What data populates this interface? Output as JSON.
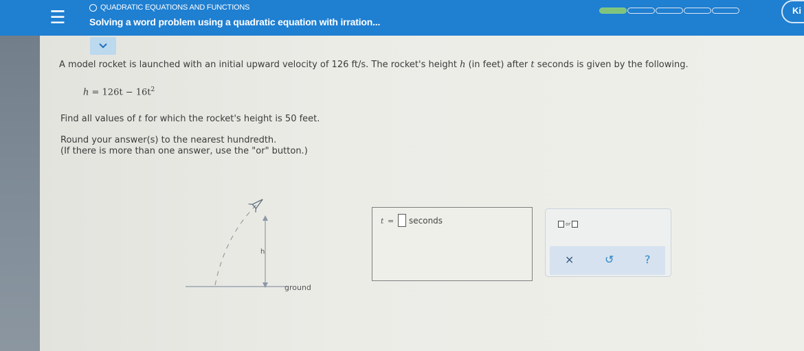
{
  "header": {
    "menu_icon": "hamburger-menu-icon",
    "topic": "QUADRATIC EQUATIONS AND FUNCTIONS",
    "lesson_title": "Solving a word problem using a quadratic equation with irration...",
    "progress": {
      "filled": 1,
      "total": 5
    },
    "profile_label": "Ki",
    "colors": {
      "bar": "#1f7fd1",
      "progress_fill": "#7fc47a"
    }
  },
  "expand_icon": "chevron-down-icon",
  "problem": {
    "intro_a": "A model rocket is launched with an initial upward velocity of 126",
    "intro_unit": "ft/s",
    "intro_b": ". The rocket's height",
    "var_h": "h",
    "intro_c": "(in feet) after",
    "var_t": "t",
    "intro_d": "seconds is given by the following.",
    "formula": {
      "lhs": "h",
      "rhs": " = 126t − 16t",
      "exponent": "2"
    },
    "find_a": "Find all values of",
    "find_var": "t",
    "find_b": "for which the rocket's height is 50 feet.",
    "round_line1": "Round your answer(s) to the nearest hundredth.",
    "round_line2": "(If there is more than one answer, use the \"or\" button.)"
  },
  "diagram": {
    "height_label": "h",
    "ground_label": "ground",
    "rocket_icon": "rocket-icon"
  },
  "answer": {
    "variable": "t",
    "equals": "=",
    "value": "",
    "unit": "seconds"
  },
  "tools": {
    "or_label": "or",
    "clear_symbol": "×",
    "undo_symbol": "↺",
    "help_symbol": "?",
    "colors": {
      "clear": "#335577",
      "undo": "#2e86c8",
      "help": "#2e86c8"
    }
  }
}
